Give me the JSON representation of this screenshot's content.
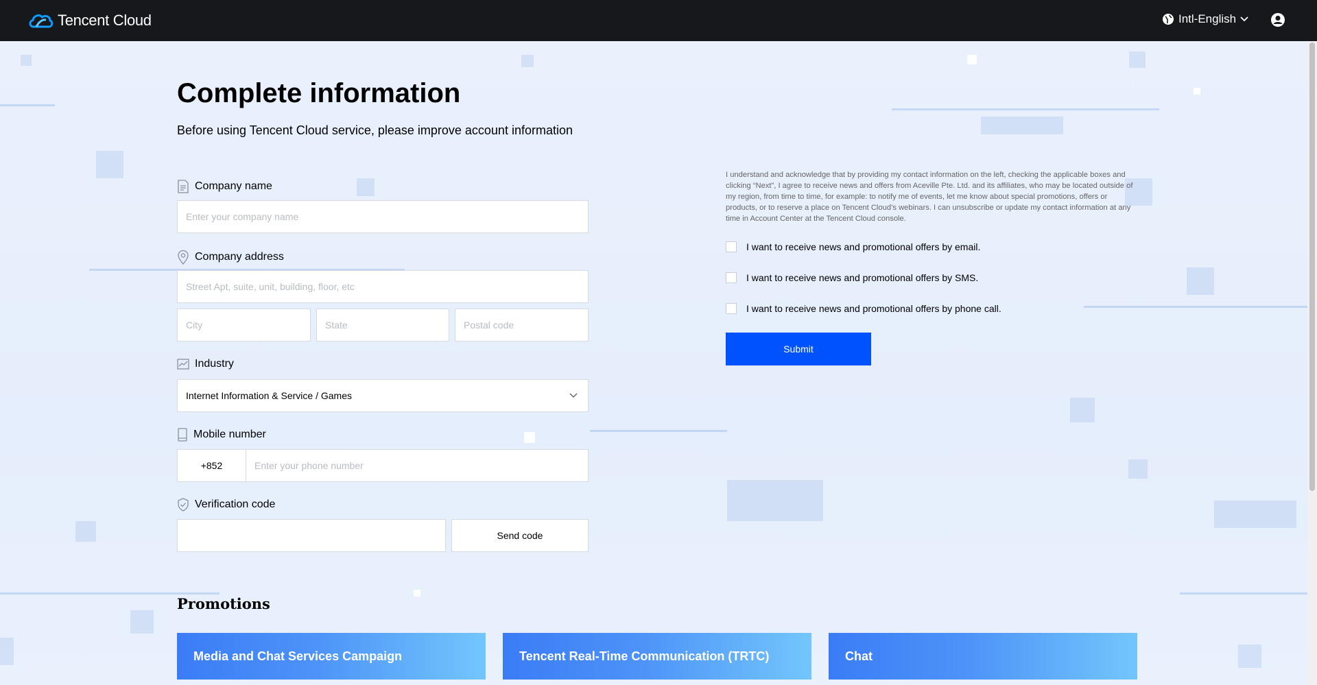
{
  "header": {
    "brand": "Tencent Cloud",
    "language": "Intl-English"
  },
  "page": {
    "title": "Complete information",
    "subtitle": "Before using Tencent Cloud service, please improve account information"
  },
  "form": {
    "company_name": {
      "label": "Company name",
      "placeholder": "Enter your company name",
      "icon": "document-icon"
    },
    "company_address": {
      "label": "Company address",
      "icon": "location-pin-icon",
      "street_placeholder": "Street Apt, suite, unit, building, floor, etc",
      "city_placeholder": "City",
      "state_placeholder": "State",
      "postal_placeholder": "Postal code"
    },
    "industry": {
      "label": "Industry",
      "icon": "chart-icon",
      "selected": "Internet Information & Service / Games"
    },
    "mobile": {
      "label": "Mobile number",
      "icon": "phone-icon",
      "country_code": "+852",
      "placeholder": "Enter your phone number"
    },
    "verification": {
      "label": "Verification code",
      "icon": "shield-check-icon",
      "placeholder": "",
      "send_label": "Send code"
    }
  },
  "consent": {
    "text": "I understand and acknowledge that by providing my contact information on the left, checking the applicable boxes and clicking “Next”, I agree to receive news and offers from Aceville Pte. Ltd. and its affiliates, who may be located outside of my region, from time to time, for example: to notify me of events, let me know about special promotions, offers or products, or to reserve a place on Tencent Cloud’s webinars. I can unsubscribe or update my contact information at any time in Account Center at the Tencent Cloud console.",
    "options": [
      "I want to receive news and promotional offers by email.",
      "I want to receive news and promotional offers by SMS.",
      "I want to receive news and promotional offers by phone call."
    ],
    "submit_label": "Submit"
  },
  "promotions": {
    "title": "Promotions",
    "cards": [
      "Media and Chat Services Campaign",
      "Tencent Real-Time Communication (TRTC)",
      "Chat"
    ]
  },
  "colors": {
    "nav_bg": "#16181c",
    "primary": "#0052ff",
    "page_bg": "#e8f0fc"
  }
}
